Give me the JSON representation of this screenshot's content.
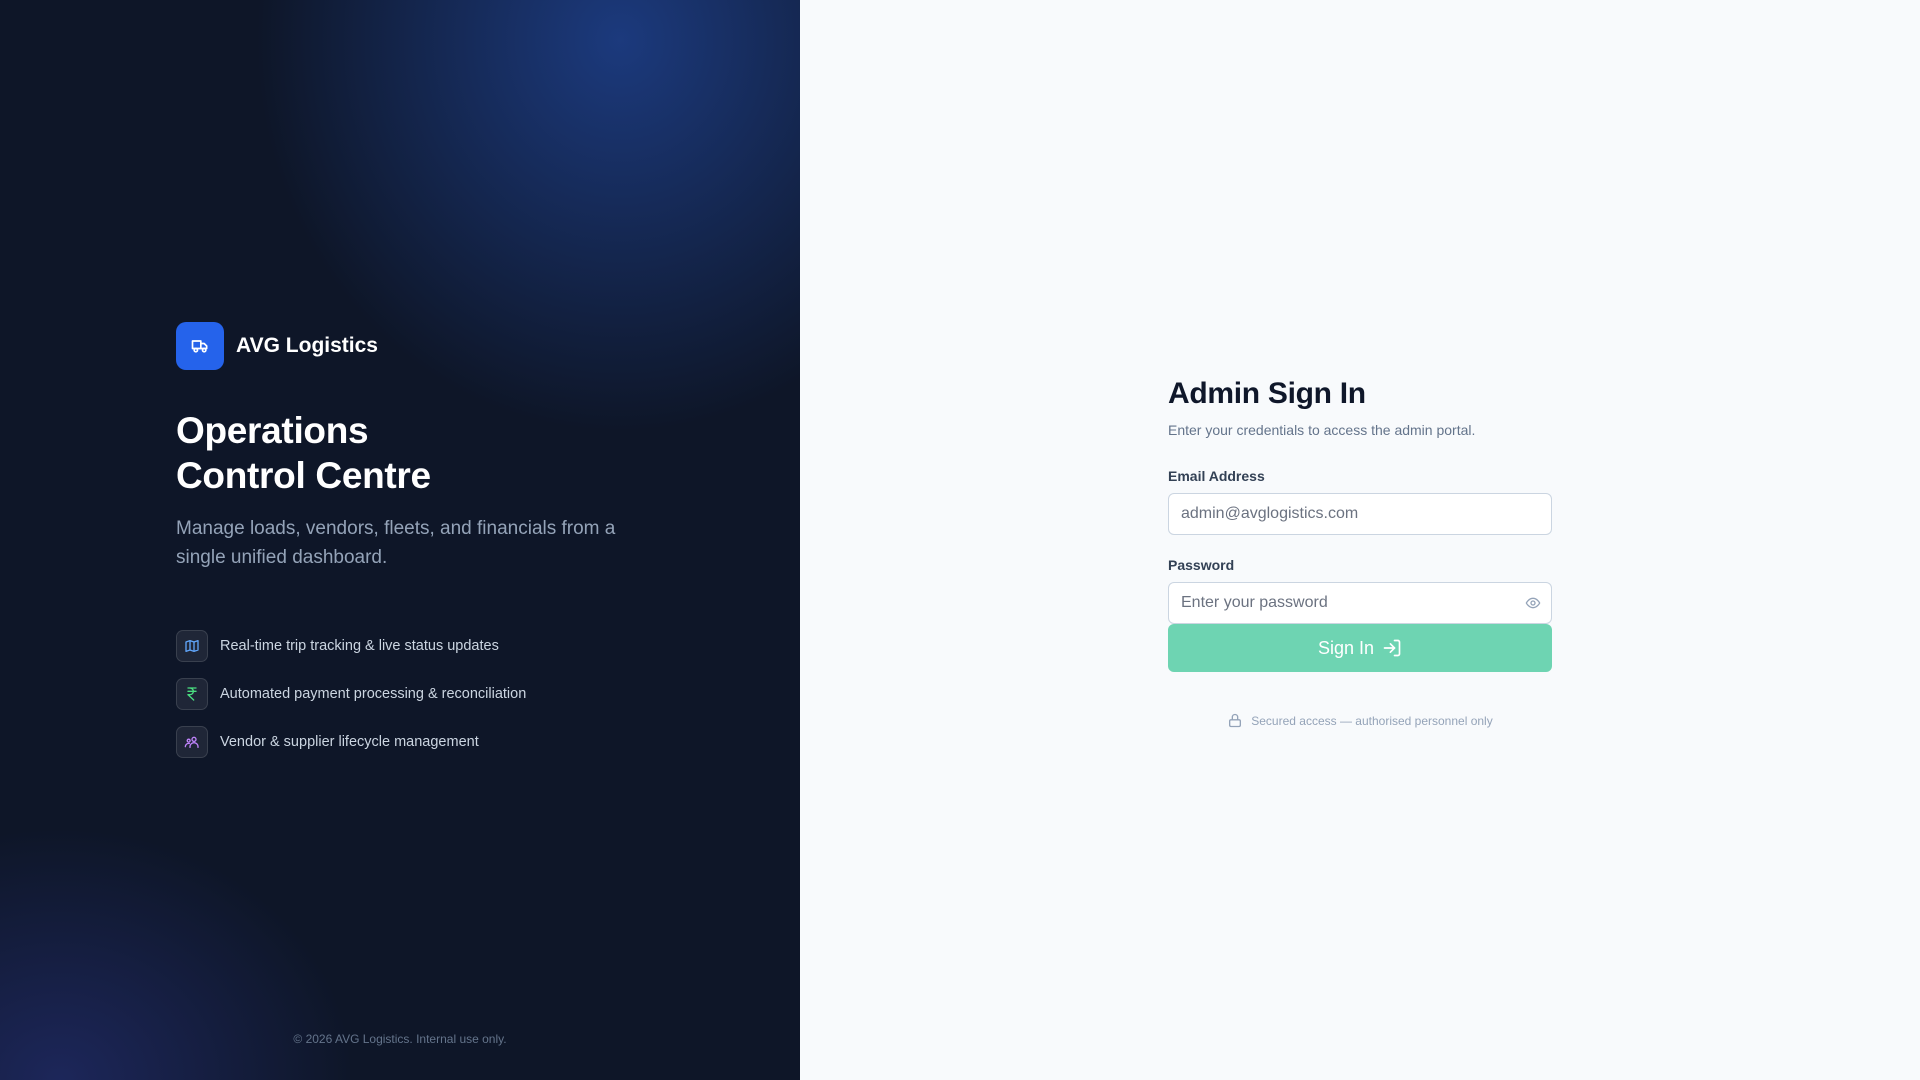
{
  "brand": {
    "name": "AVG Logistics",
    "logo_icon": "truck-icon",
    "logo_color": "#2563eb"
  },
  "hero": {
    "title_line1": "Operations",
    "title_line2": "Control Centre",
    "subtitle": "Manage loads, vendors, fleets, and financials from a single unified dashboard."
  },
  "features": [
    {
      "icon": "map-icon",
      "color": "#60a5fa",
      "text": "Real-time trip tracking & live status updates"
    },
    {
      "icon": "rupee-icon",
      "color": "#4ade80",
      "text": "Automated payment processing & reconciliation"
    },
    {
      "icon": "users-icon",
      "color": "#c084fc",
      "text": "Vendor & supplier lifecycle management"
    }
  ],
  "footer": {
    "copyright": "© 2026 AVG Logistics. Internal use only."
  },
  "form": {
    "title": "Admin Sign In",
    "subtitle": "Enter your credentials to access the admin portal.",
    "email_label": "Email Address",
    "email_placeholder": "admin@avglogistics.com",
    "password_label": "Password",
    "password_placeholder": "Enter your password",
    "submit_label": "Sign In",
    "submit_color": "#6ed4b2",
    "secure_note": "Secured access — authorised personnel only"
  }
}
